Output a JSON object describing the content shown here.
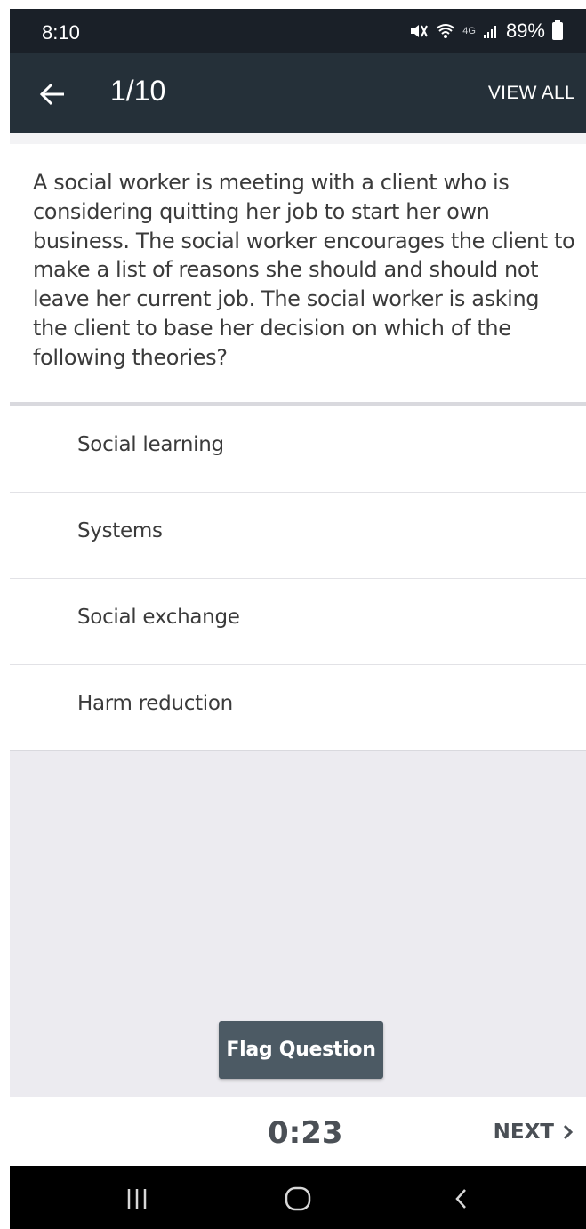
{
  "status_bar": {
    "time": "8:10",
    "network": "4G",
    "battery": "89%"
  },
  "header": {
    "counter": "1/10",
    "view_all": "VIEW ALL"
  },
  "question": {
    "text": "A social worker is meeting with a client who is considering quitting her job to start her own business. The social worker encourages the client to make a list of reasons she should and should not leave her current job. The social worker is asking the client to base her decision on which of the following theories?"
  },
  "options": [
    {
      "label": "Social learning"
    },
    {
      "label": "Systems"
    },
    {
      "label": "Social exchange"
    },
    {
      "label": "Harm reduction"
    }
  ],
  "actions": {
    "flag": "Flag Question",
    "timer": "0:23",
    "next": "NEXT"
  },
  "colors": {
    "status_bar": "#1a2028",
    "app_bar": "#253039",
    "flag_button": "#4c5a64",
    "background": "#ecebf0"
  }
}
